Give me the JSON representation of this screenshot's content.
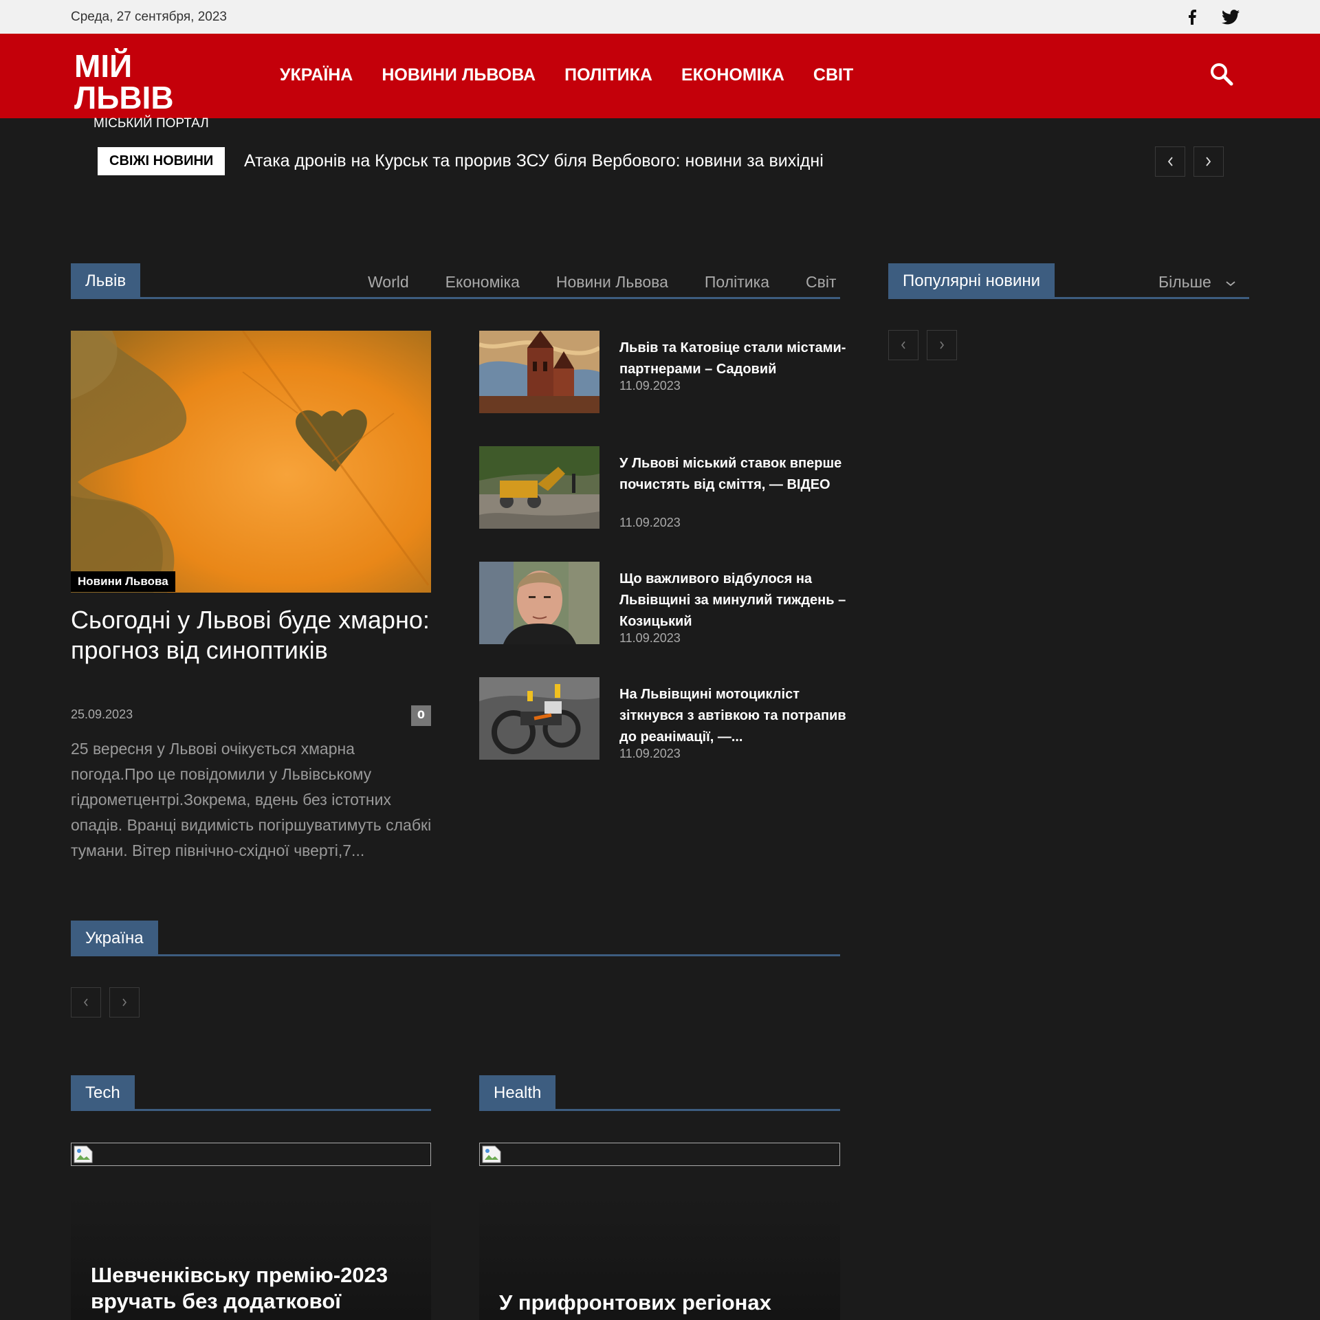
{
  "topbar": {
    "date": "Среда, 27 сентября, 2023"
  },
  "header": {
    "logo_title": "МІЙ ЛЬВІВ",
    "logo_subtitle": "МІСЬКИЙ ПОРТАЛ",
    "nav": [
      "УКРАЇНА",
      "НОВИНИ ЛЬВОВА",
      "ПОЛІТИКА",
      "ЕКОНОМІКА",
      "СВІТ"
    ]
  },
  "ticker": {
    "badge": "СВІЖІ НОВИНИ",
    "headline": "Атака дронів на Курськ та прорив ЗСУ біля Вербового: новини за вихідні"
  },
  "lviv_block": {
    "title": "Львів",
    "filters": [
      "World",
      "Економіка",
      "Новини Львова",
      "Політика",
      "Світ"
    ],
    "main": {
      "category": "Новини Львова",
      "title": "Сьогодні у Львові буде хмарно: прогноз від синоптиків",
      "date": "25.09.2023",
      "comments": "0",
      "excerpt": "25 вересня у Львові очікується хмарна погода.Про це повідомили у Львівському гідрометцентрі.Зокрема, вдень без істотних опадів. Вранці видимість погіршуватимуть слабкі тумани. Вітер північно-східної чверті,7..."
    },
    "items": [
      {
        "title": "Львів та Катовіце стали містами-партнерами – Садовий",
        "date": "11.09.2023"
      },
      {
        "title": "У Львові міський ставок вперше почистять від сміття, — ВІДЕО",
        "date": "11.09.2023"
      },
      {
        "title": "Що важливого відбулося на Львівщині за минулий тиждень – Козицький",
        "date": "11.09.2023"
      },
      {
        "title": "На Львівщині мотоцикліст зіткнувся з автівкою та потрапив до реанімації, —...",
        "date": "11.09.2023"
      }
    ]
  },
  "popular_block": {
    "title": "Популярні новини",
    "more": "Більше"
  },
  "ukraine_block": {
    "title": "Україна"
  },
  "tech_block": {
    "title": "Tech",
    "headline": "Шевченківську премію-2023 вручать без додаткової"
  },
  "health_block": {
    "title": "Health",
    "headline": "У прифронтових регіонах"
  },
  "colors": {
    "brand_red": "#c4000a",
    "block_blue": "#3d5d80",
    "background": "#1b1b1b"
  }
}
